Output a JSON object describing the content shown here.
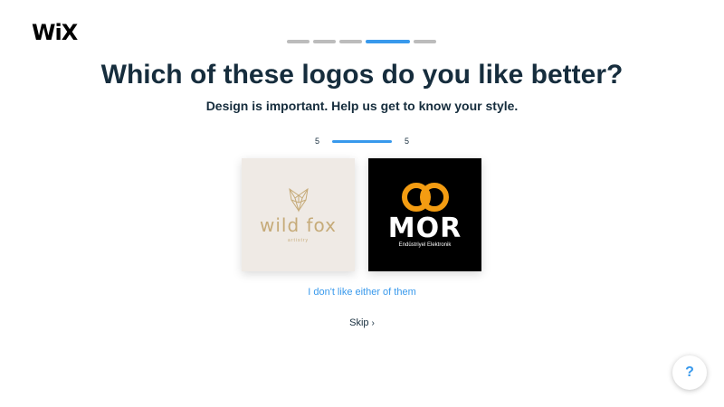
{
  "brand": {
    "logo_text": "WiX"
  },
  "progress": {
    "steps": 5,
    "active_step": 4
  },
  "main": {
    "title": "Which of these logos do you like better?",
    "subtitle": "Design is important. Help us get to know your style.",
    "counter": {
      "left": "5",
      "right": "5",
      "fill": 1.0
    },
    "options": [
      {
        "name": "wild-fox",
        "text": "wild fox",
        "subtext": "artistry",
        "bg": "#efeae5",
        "accent": "#c6ab79"
      },
      {
        "name": "mor",
        "text": "MOR",
        "subtext": "Endüstriyel Elektronik",
        "bg": "#000000",
        "accent": "#f39c12"
      }
    ],
    "neither_label": "I don't like either of them",
    "skip_label": "Skip",
    "skip_icon": "chevron-right-icon"
  },
  "help": {
    "label": "?"
  },
  "colors": {
    "accent": "#3899ec",
    "text": "#162d3d",
    "progress_inactive": "#bcbcbc"
  }
}
